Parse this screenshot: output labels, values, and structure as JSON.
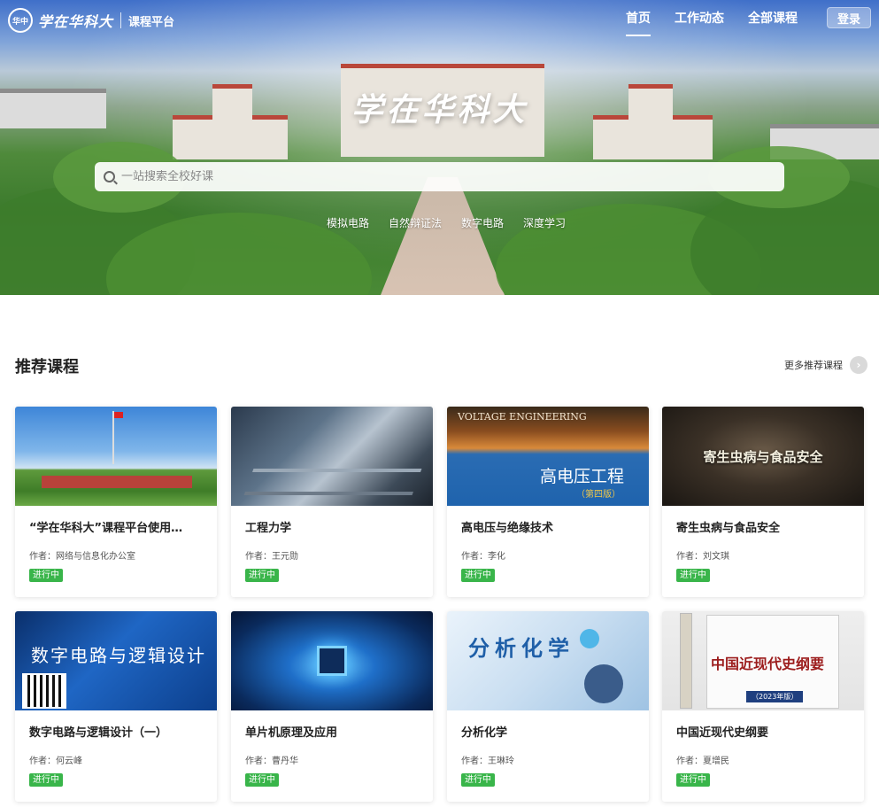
{
  "header": {
    "logo_seal": "华中",
    "logo_text": "学在华科大",
    "platform": "课程平台",
    "nav": [
      {
        "label": "首页",
        "active": true
      },
      {
        "label": "工作动态",
        "active": false
      },
      {
        "label": "全部课程",
        "active": false
      }
    ],
    "login": "登录"
  },
  "hero": {
    "title": "学在华科大",
    "search_placeholder": "一站搜索全校好课",
    "hot_tags": [
      "模拟电路",
      "自然辩证法",
      "数字电路",
      "深度学习"
    ]
  },
  "section": {
    "title": "推荐课程",
    "more": "更多推荐课程"
  },
  "courses": [
    {
      "title": "“学在华科大”课程平台使用…",
      "author": "作者：网络与信息化办公室",
      "status": "进行中",
      "thumb_text": ""
    },
    {
      "title": "工程力学",
      "author": "作者：王元勋",
      "status": "进行中",
      "thumb_text": ""
    },
    {
      "title": "高电压与绝缘技术",
      "author": "作者：李化",
      "status": "进行中",
      "thumb_text": "高电压工程",
      "thumb_sub": "（第四版）",
      "thumb_top": "VOLTAGE ENGINEERING"
    },
    {
      "title": "寄生虫病与食品安全",
      "author": "作者：刘文琪",
      "status": "进行中",
      "thumb_text": "寄生虫病与食品安全"
    },
    {
      "title": "数字电路与逻辑设计（一）",
      "author": "作者：何云峰",
      "status": "进行中",
      "thumb_text": "数字电路与逻辑设计"
    },
    {
      "title": "单片机原理及应用",
      "author": "作者：曹丹华",
      "status": "进行中",
      "thumb_text": ""
    },
    {
      "title": "分析化学",
      "author": "作者：王琳玲",
      "status": "进行中",
      "thumb_text": "分析化学"
    },
    {
      "title": "中国近现代史纲要",
      "author": "作者：夏增民",
      "status": "进行中",
      "thumb_text": "中国近现代史纲要",
      "thumb_sub": "（2023年版）"
    }
  ],
  "colors": {
    "badge": "#39b54a",
    "hero_sky": "#3f6fc9"
  }
}
